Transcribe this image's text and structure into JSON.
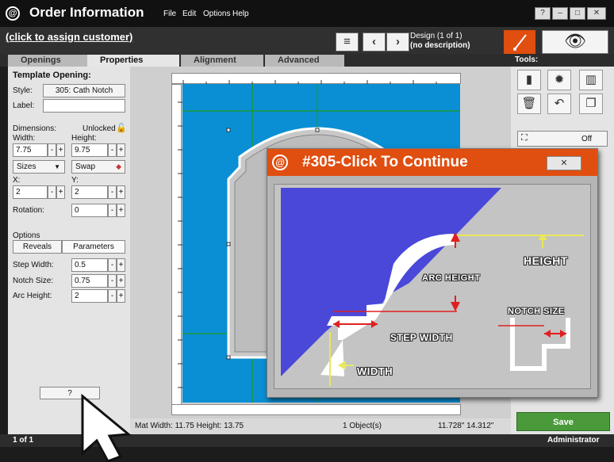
{
  "title_bar": {
    "title": "Order Information",
    "menu": [
      "File",
      "Edit",
      "Options",
      "Help"
    ]
  },
  "header": {
    "customer_link": "(click to assign customer)",
    "design_line1": "Design  (1 of 1)",
    "design_line2": "(no description)"
  },
  "tabs": [
    "Openings",
    "Properties",
    "Alignment",
    "Advanced"
  ],
  "panel": {
    "section_title": "Template Opening:",
    "style_label": "Style:",
    "style_value": "305: Cath Notch",
    "label_label": "Label:",
    "label_value": "",
    "dimensions_label": "Dimensions:",
    "unlocked_label": "Unlocked",
    "width_label": "Width:",
    "height_label": "Height:",
    "width_value": "7.75",
    "height_value": "9.75",
    "sizes_label": "Sizes",
    "swap_label": "Swap",
    "x_label": "X:",
    "y_label": "Y:",
    "x_value": "2",
    "y_value": "2",
    "rotation_label": "Rotation:",
    "rotation_value": "0",
    "options_label": "Options",
    "reveals_tab": "Reveals",
    "parameters_tab": "Parameters",
    "step_width_label": "Step Width:",
    "step_width_value": "0.5",
    "notch_size_label": "Notch Size:",
    "notch_size_value": "0.75",
    "arc_height_label": "Arc Height:",
    "arc_height_value": "2",
    "help_button": "?"
  },
  "status": {
    "mat_size": "Mat  Width: 11.75  Height: 13.75",
    "objects": "1 Object(s)",
    "coords": "11.728\"  14.312\""
  },
  "tools": {
    "heading": "Tools:",
    "off_label": "Off",
    "save_label": "Save"
  },
  "bottom": {
    "page": "1 of 1",
    "user": "Administrator"
  },
  "dialog": {
    "title": "#305-Click To Continue",
    "labels": {
      "height": "HEIGHT",
      "arc_height": "ARC HEIGHT",
      "notch_size": "NOTCH SIZE",
      "step_width": "STEP WIDTH",
      "width": "WIDTH"
    }
  },
  "colors": {
    "accent": "#e04e10",
    "mat": "#0a8fd4",
    "save": "#4a9a3c",
    "diagram_fill": "#4a48d8"
  }
}
